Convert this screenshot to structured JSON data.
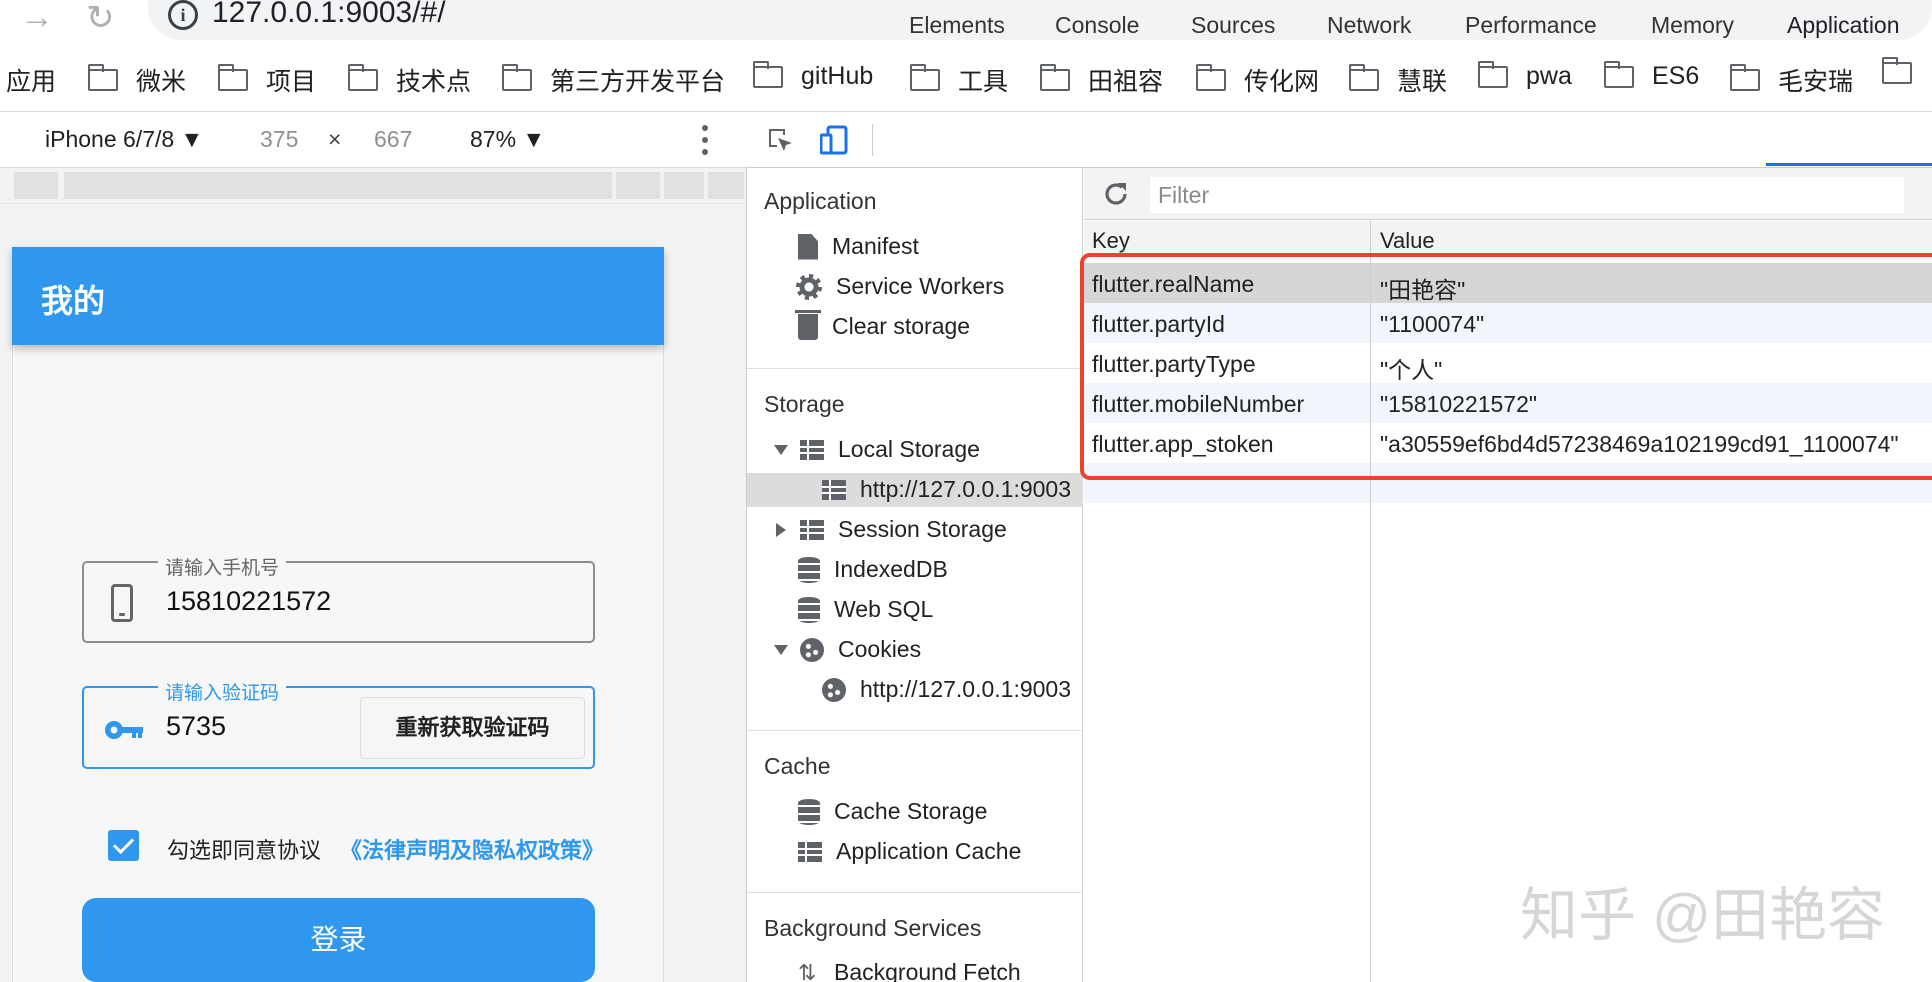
{
  "browser": {
    "url": "127.0.0.1:9003/#/",
    "bookmarks": [
      "应用",
      "微米",
      "项目",
      "技术点",
      "第三方开发平台",
      "gitHub",
      "工具",
      "田祖容",
      "传化网",
      "慧联",
      "pwa",
      "ES6",
      "毛安瑞"
    ]
  },
  "device_toolbar": {
    "device": "iPhone 6/7/8 ▼",
    "width": "375",
    "times": "×",
    "height": "667",
    "zoom": "87% ▼"
  },
  "app": {
    "title": "我的",
    "phone_label": "请输入手机号",
    "phone_value": "15810221572",
    "code_label": "请输入验证码",
    "code_value": "5735",
    "resend_label": "重新获取验证码",
    "agree_text": "勾选即同意协议",
    "agree_link": "《法律声明及隐私权政策》",
    "agree_checked": true,
    "login_label": "登录",
    "accent_color": "#2f98ee"
  },
  "devtools": {
    "tabs": [
      "Elements",
      "Console",
      "Sources",
      "Network",
      "Performance",
      "Memory",
      "Application"
    ],
    "active_tab": "Application",
    "sidebar": {
      "application_header": "Application",
      "application_items": [
        "Manifest",
        "Service Workers",
        "Clear storage"
      ],
      "storage_header": "Storage",
      "local_storage": "Local Storage",
      "local_storage_origin": "http://127.0.0.1:9003",
      "session_storage": "Session Storage",
      "indexeddb": "IndexedDB",
      "websql": "Web SQL",
      "cookies": "Cookies",
      "cookies_origin": "http://127.0.0.1:9003",
      "cache_header": "Cache",
      "cache_items": [
        "Cache Storage",
        "Application Cache"
      ],
      "bg_header": "Background Services",
      "bg_items": [
        "Background Fetch"
      ]
    },
    "storage": {
      "filter_placeholder": "Filter",
      "col_key": "Key",
      "col_value": "Value",
      "rows": [
        {
          "key": "flutter.realName",
          "value": "\"田艳容\""
        },
        {
          "key": "flutter.partyId",
          "value": "\"1100074\""
        },
        {
          "key": "flutter.partyType",
          "value": "\"个人\""
        },
        {
          "key": "flutter.mobileNumber",
          "value": "\"15810221572\""
        },
        {
          "key": "flutter.app_stoken",
          "value": "\"a30559ef6bd4d57238469a102199cd91_1100074\""
        }
      ],
      "selected_row": 0
    }
  },
  "watermark": "知乎 @田艳容"
}
